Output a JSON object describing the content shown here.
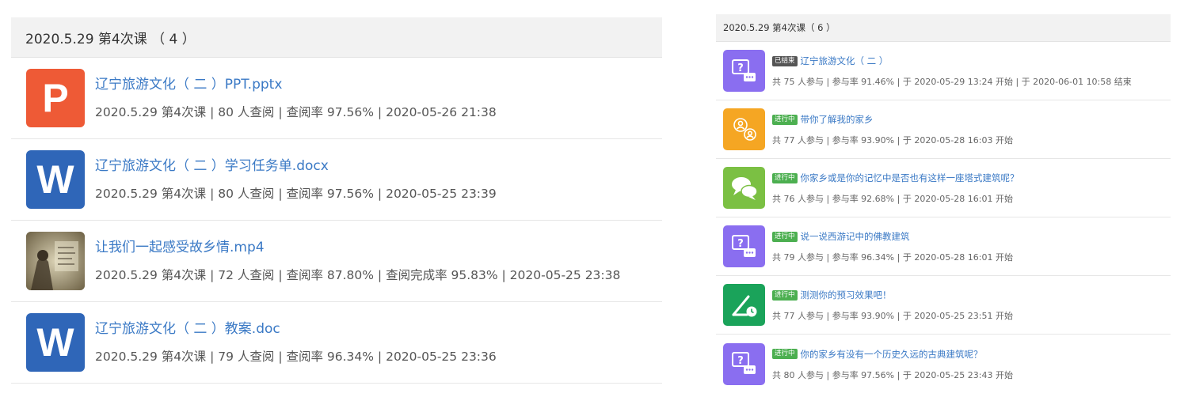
{
  "left": {
    "header": "2020.5.29 第4次课 （ 4 ）",
    "files": [
      {
        "icon": "ppt-icon",
        "icon_letter": "P",
        "title": "辽宁旅游文化（ 二 ）PPT.pptx",
        "meta": "2020.5.29 第4次课 | 80 人查阅 | 查阅率 97.56% | 2020-05-26 21:38"
      },
      {
        "icon": "word-icon",
        "icon_letter": "W",
        "title": "辽宁旅游文化（ 二 ）学习任务单.docx",
        "meta": "2020.5.29 第4次课 | 80 人查阅 | 查阅率 97.56% | 2020-05-25 23:39"
      },
      {
        "icon": "video-thumbnail",
        "icon_letter": "",
        "title": "让我们一起感受故乡情.mp4",
        "meta": "2020.5.29 第4次课 | 72 人查阅 | 查阅率 87.80% | 查阅完成率 95.83% | 2020-05-25 23:38"
      },
      {
        "icon": "word-icon",
        "icon_letter": "W",
        "title": "辽宁旅游文化（ 二 ）教案.doc",
        "meta": "2020.5.29 第4次课 | 79 人查阅 | 查阅率 96.34% | 2020-05-25 23:36"
      }
    ]
  },
  "right": {
    "header": "2020.5.29 第4次课（ 6 ）",
    "activities": [
      {
        "icon": "question-icon",
        "icon_color": "#8a6ef0",
        "badge": "已结束",
        "badge_color": "#555555",
        "title": "辽宁旅游文化（ 二 ）",
        "meta": "共 75 人参与 | 参与率 91.46% | 于 2020-05-29 13:24 开始 | 于 2020-06-01 10:58 结束"
      },
      {
        "icon": "group-task-icon",
        "icon_color": "#f5a623",
        "badge": "进行中",
        "badge_color": "#4caf50",
        "title": "带你了解我的家乡",
        "meta": "共 77 人参与 | 参与率 93.90% | 于 2020-05-28 16:03 开始"
      },
      {
        "icon": "discussion-icon",
        "icon_color": "#7bc043",
        "badge": "进行中",
        "badge_color": "#4caf50",
        "title": "你家乡或是你的记忆中是否也有这样一座塔式建筑呢？",
        "meta": "共 76 人参与 | 参与率 92.68% | 于 2020-05-28 16:01 开始"
      },
      {
        "icon": "question-icon",
        "icon_color": "#8a6ef0",
        "badge": "进行中",
        "badge_color": "#4caf50",
        "title": "说一说西游记中的佛教建筑",
        "meta": "共 79 人参与 | 参与率 96.34% | 于 2020-05-28 16:01 开始"
      },
      {
        "icon": "quiz-icon",
        "icon_color": "#1aa35a",
        "badge": "进行中",
        "badge_color": "#4caf50",
        "title": "测测你的预习效果吧！",
        "meta": "共 77 人参与 | 参与率 93.90% | 于 2020-05-25 23:51 开始"
      },
      {
        "icon": "question-icon",
        "icon_color": "#8a6ef0",
        "badge": "进行中",
        "badge_color": "#4caf50",
        "title": "你的家乡有没有一个历史久远的古典建筑呢？",
        "meta": "共 80 人参与 | 参与率 97.56% | 于 2020-05-25 23:43 开始"
      }
    ]
  }
}
